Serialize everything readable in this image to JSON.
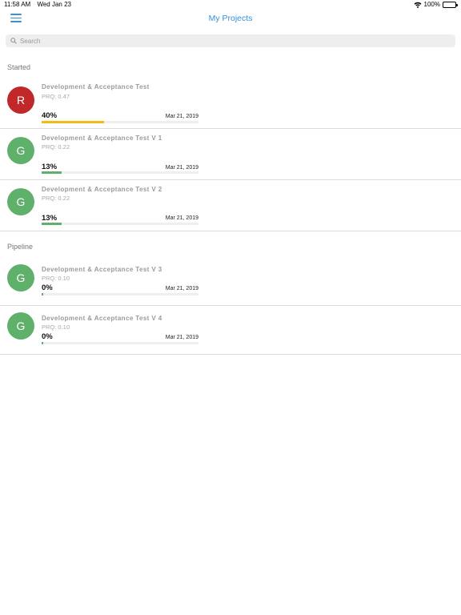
{
  "status_bar": {
    "time": "11:58 AM",
    "date": "Wed Jan 23",
    "battery": "100%"
  },
  "nav": {
    "title": "My Projects"
  },
  "search": {
    "placeholder": "Search"
  },
  "sections": [
    {
      "label": "Started",
      "items": [
        {
          "initial": "R",
          "avatar_color": "#c0282a",
          "title": "Development & Acceptance Test",
          "prq": "PRQ: 0.47",
          "percent_label": "40%",
          "progress": 0.4,
          "bar_color": "#f2bd12",
          "date": "Mar 21, 2019"
        },
        {
          "initial": "G",
          "avatar_color": "#5fb06a",
          "title": "Development & Acceptance Test V 1",
          "prq": "PRQ: 0.22",
          "percent_label": "13%",
          "progress": 0.13,
          "bar_color": "#5fb06a",
          "date": "Mar 21, 2019"
        },
        {
          "initial": "G",
          "avatar_color": "#5fb06a",
          "title": "Development & Acceptance Test V 2",
          "prq": "PRQ: 0.22",
          "percent_label": "13%",
          "progress": 0.13,
          "bar_color": "#5fb06a",
          "date": "Mar 21, 2019"
        }
      ]
    },
    {
      "label": "Pipeline",
      "items": [
        {
          "initial": "G",
          "avatar_color": "#5fb06a",
          "title": "Development & Acceptance Test V 3",
          "prq": "PRQ: 0.10",
          "percent_label": "0%",
          "progress": 0.0,
          "bar_color": "#5fb06a",
          "date": "Mar 21, 2019"
        },
        {
          "initial": "G",
          "avatar_color": "#5fb06a",
          "title": "Development & Acceptance Test V 4",
          "prq": "PRQ: 0.10",
          "percent_label": "0%",
          "progress": 0.0,
          "bar_color": "#5fb06a",
          "date": "Mar 21, 2019"
        }
      ]
    }
  ]
}
